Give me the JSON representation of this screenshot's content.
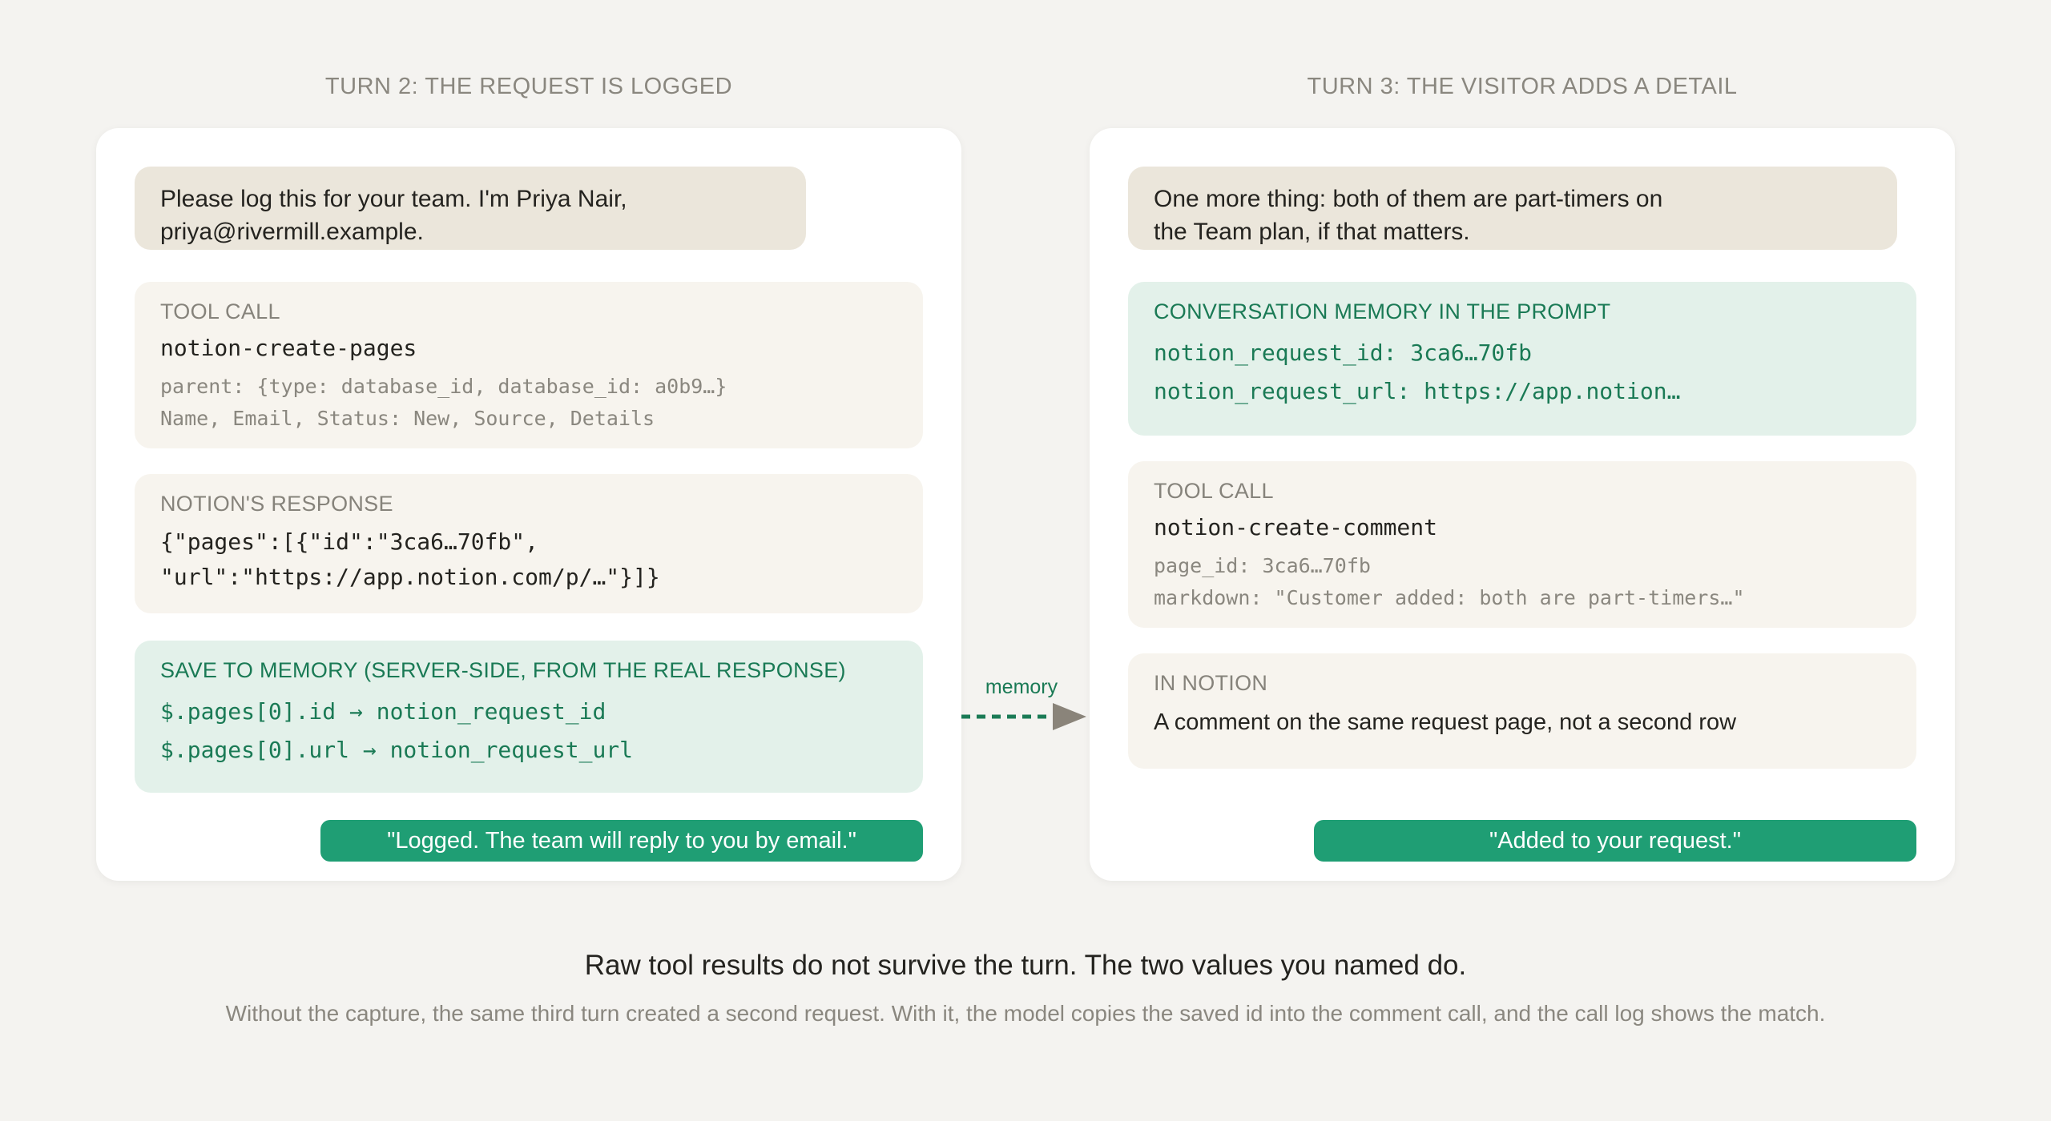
{
  "left": {
    "title": "TURN 2: THE REQUEST IS LOGGED",
    "visitor_message_line1": "Please log this for your team. I'm Priya Nair,",
    "visitor_message_line2": "priya@rivermill.example.",
    "tool_call": {
      "label": "TOOL CALL",
      "name": "notion-create-pages",
      "arg1": "parent: {type: database_id, database_id: a0b9…}",
      "arg2": "Name, Email, Status: New, Source, Details"
    },
    "response": {
      "label": "NOTION'S RESPONSE",
      "line1": "{\"pages\":[{\"id\":\"3ca6…70fb\",",
      "line2": "\"url\":\"https://app.notion.com/p/…\"}]}"
    },
    "save": {
      "label": "SAVE TO MEMORY (SERVER-SIDE, FROM THE REAL RESPONSE)",
      "line1": "$.pages[0].id → notion_request_id",
      "line2": "$.pages[0].url → notion_request_url"
    },
    "reply": "\"Logged. The team will reply to you by email.\""
  },
  "connector_label": "memory",
  "right": {
    "title": "TURN 3: THE VISITOR ADDS A DETAIL",
    "visitor_message_line1": "One more thing: both of them are part-timers on",
    "visitor_message_line2": "the Team plan, if that matters.",
    "memory": {
      "label": "CONVERSATION MEMORY IN THE PROMPT",
      "line1": "notion_request_id: 3ca6…70fb",
      "line2": "notion_request_url: https://app.notion…"
    },
    "tool_call": {
      "label": "TOOL CALL",
      "name": "notion-create-comment",
      "arg1": "page_id: 3ca6…70fb",
      "arg2": "markdown: \"Customer added: both are part-timers…\""
    },
    "in_notion": {
      "label": "IN NOTION",
      "text": "A comment on the same request page, not a second row"
    },
    "reply": "\"Added to your request.\""
  },
  "footer": {
    "headline": "Raw tool results do not survive the turn. The two values you named do.",
    "subline": "Without the capture, the same third turn created a second request. With it, the model copies the saved id into the comment call, and the call log shows the match."
  },
  "colors": {
    "background": "#f4f3f0",
    "bubble": "#ebe6db",
    "tool_box": "#f7f4ee",
    "memory_box": "#e3f1ea",
    "accent_green": "#1f9e74",
    "label_green": "#1a7a55",
    "connector_arrow": "#8a847a"
  }
}
